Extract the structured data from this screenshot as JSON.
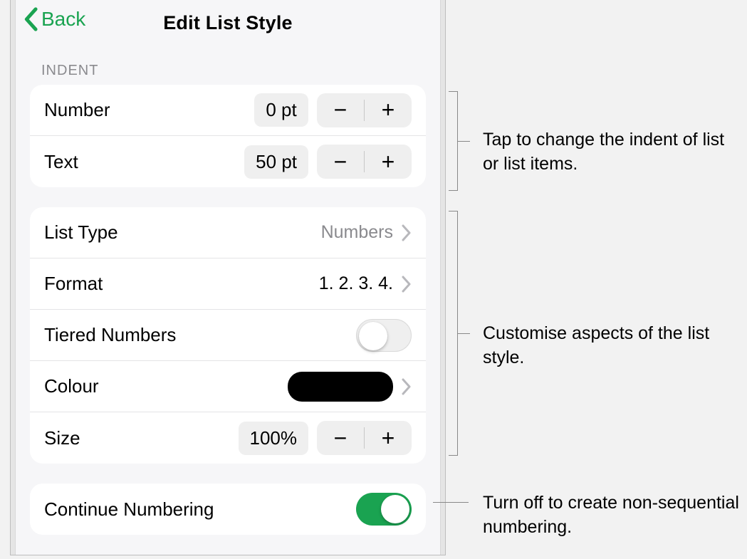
{
  "header": {
    "back_label": "Back",
    "title": "Edit List Style"
  },
  "sections": {
    "indent_header": "INDENT"
  },
  "indent": {
    "number": {
      "label": "Number",
      "value": "0 pt"
    },
    "text": {
      "label": "Text",
      "value": "50 pt"
    }
  },
  "style": {
    "list_type": {
      "label": "List Type",
      "value": "Numbers"
    },
    "format": {
      "label": "Format",
      "value": "1. 2. 3. 4."
    },
    "tiered": {
      "label": "Tiered Numbers",
      "on": false
    },
    "colour": {
      "label": "Colour",
      "swatch": "#000000"
    },
    "size": {
      "label": "Size",
      "value": "100%"
    }
  },
  "continue_numbering": {
    "label": "Continue Numbering",
    "on": true
  },
  "callouts": {
    "indent": "Tap to change the indent of list or list items.",
    "style": "Customise aspects of the list style.",
    "continue": "Turn off to create non-sequential numbering."
  },
  "glyphs": {
    "minus": "−",
    "plus": "+"
  }
}
